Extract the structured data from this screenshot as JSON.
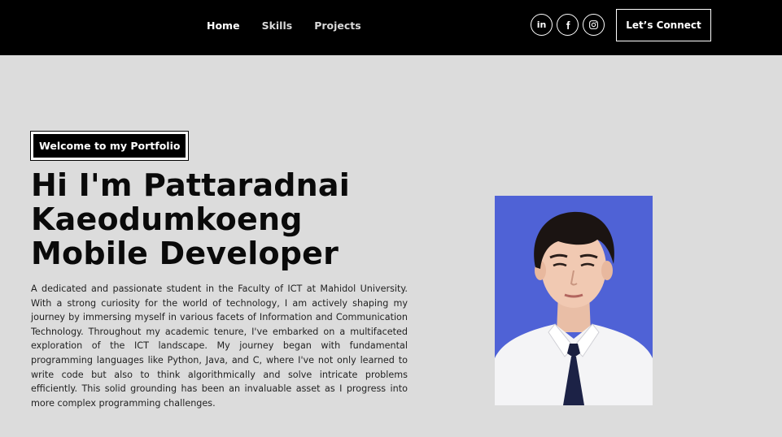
{
  "nav": {
    "links": [
      "Home",
      "Skills",
      "Projects"
    ],
    "socials": [
      "linkedin-icon",
      "facebook-icon",
      "instagram-icon"
    ],
    "linkedin_label": "in",
    "connect_label": "Let’s Connect"
  },
  "hero": {
    "tagline": "Welcome to my Portfolio",
    "headline_line1": "Hi I'm Pattaradnai",
    "headline_line2": "Kaeodumkoeng",
    "headline_line3": "Mobile Developer",
    "bio": "A dedicated and passionate student in the Faculty of ICT at Mahidol University. With a strong curiosity for the world of technology, I am actively shaping my journey by immersing myself in various facets of Information and Communication Technology. Throughout my academic tenure, I've embarked on a multifaceted exploration of the ICT landscape. My journey began with fundamental programming languages like Python, Java, and C, where I've not only learned to write code but also to think algorithmically and solve intricate problems efficiently. This solid grounding has been an invaluable asset as I progress into more complex programming challenges."
  },
  "colors": {
    "navbar_bg": "#000000",
    "page_bg": "#dcdcdc",
    "photo_bg": "#4f62d6",
    "text": "#0a0a0a"
  }
}
